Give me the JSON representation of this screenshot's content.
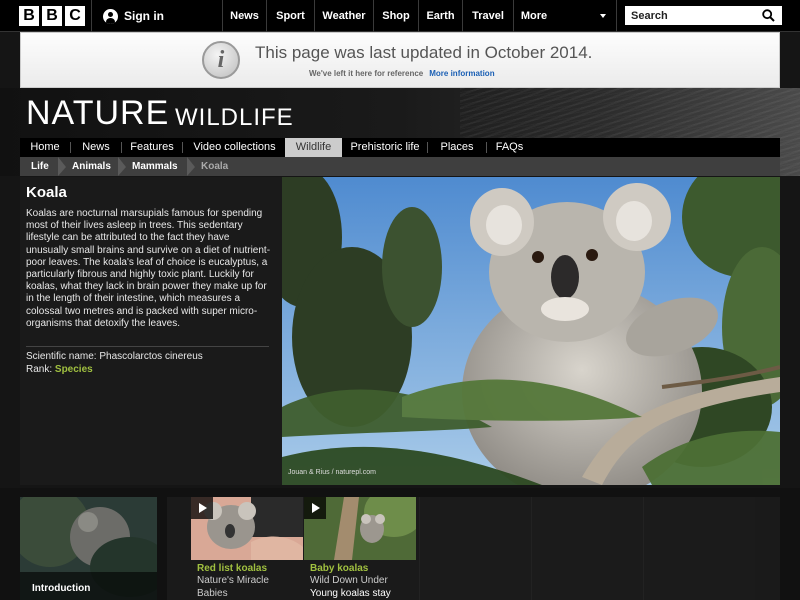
{
  "topbar": {
    "logo_letters": [
      "B",
      "B",
      "C"
    ],
    "signin_label": "Sign in",
    "nav": [
      "News",
      "Sport",
      "Weather",
      "Shop",
      "Earth",
      "Travel",
      "More"
    ],
    "search_placeholder": "Search"
  },
  "notice": {
    "title": "This page was last updated in October 2014.",
    "subtitle": "We've left it here for reference",
    "link": "More information"
  },
  "brand": {
    "title": "NATURE",
    "section": "WILDLIFE"
  },
  "section_nav": {
    "items": [
      "Home",
      "News",
      "Features",
      "Video collections",
      "Wildlife",
      "Prehistoric life",
      "Places",
      "FAQs"
    ],
    "active": "Wildlife"
  },
  "breadcrumb": [
    "Life",
    "Animals",
    "Mammals",
    "Koala"
  ],
  "species": {
    "name": "Koala",
    "description": "Koalas are nocturnal marsupials famous for spending most of their lives asleep in trees. This sedentary lifestyle can be attributed to the fact they have unusually small brains and survive on a diet of nutrient-poor leaves. The koala's leaf of choice is eucalyptus, a particularly fibrous and highly toxic plant. Luckily for koalas, what they lack in brain power they make up for in the length of their intestine, which measures a colossal two metres and is packed with super micro-organisms that detoxify the leaves.",
    "scientific_label": "Scientific name: ",
    "scientific_name": "Phascolarctos cinereus",
    "rank_label": "Rank: ",
    "rank": "Species",
    "photo_credit": "Jouan & Rius / naturepl.com"
  },
  "bottom": {
    "intro_label": "Introduction",
    "clips": [
      {
        "title": "Red list koalas",
        "source": "Nature's Miracle",
        "desc": "Babies"
      },
      {
        "title": "Baby koalas",
        "source": "Wild Down Under",
        "desc": "Young koalas stay"
      }
    ]
  },
  "colors": {
    "accent_green": "#a0c040",
    "link_blue": "#1a5fb4"
  }
}
